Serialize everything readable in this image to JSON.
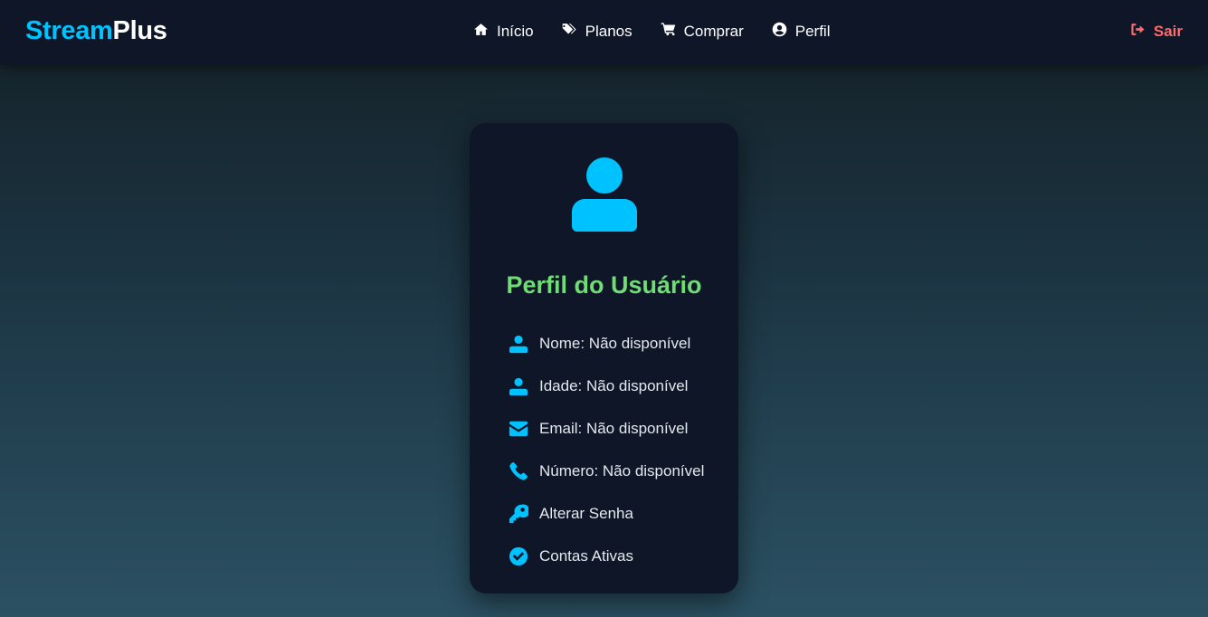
{
  "brand": {
    "part1": "Stream",
    "part2": "Plus"
  },
  "nav": {
    "items": [
      {
        "label": "Início",
        "icon": "home-icon"
      },
      {
        "label": "Planos",
        "icon": "tags-icon"
      },
      {
        "label": "Comprar",
        "icon": "cart-icon"
      },
      {
        "label": "Perfil",
        "icon": "user-circle-icon"
      }
    ],
    "logout_label": "Sair"
  },
  "profile": {
    "title": "Perfil do Usuário",
    "avatar_icon": "user-icon",
    "fields": [
      {
        "text": "Nome: Não disponível",
        "icon": "user-icon"
      },
      {
        "text": "Idade: Não disponível",
        "icon": "user-icon"
      },
      {
        "text": "Email: Não disponível",
        "icon": "envelope-icon"
      },
      {
        "text": "Número: Não disponível",
        "icon": "phone-icon"
      },
      {
        "text": "Alterar Senha",
        "icon": "key-icon"
      },
      {
        "text": "Contas Ativas",
        "icon": "check-circle-icon"
      }
    ]
  },
  "colors": {
    "accent": "#00c2ff",
    "title_green": "#6fdd74",
    "logout_red": "#ff6b6b",
    "navbar_bg": "#0e1627",
    "card_bg": "#0e1627"
  }
}
